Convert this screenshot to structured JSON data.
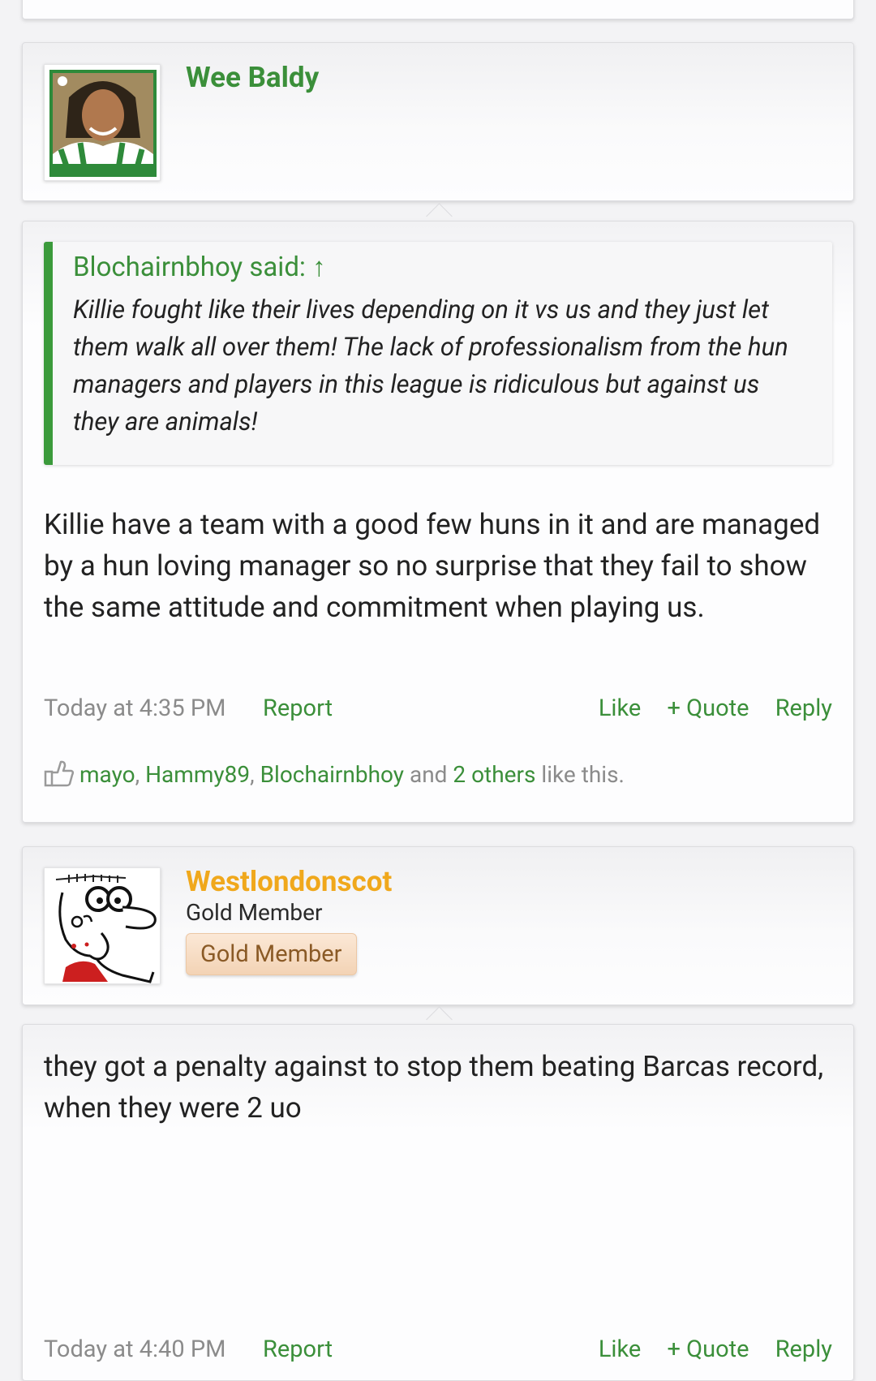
{
  "post1": {
    "username": "Wee Baldy",
    "quote": {
      "attribution": "Blochairnbhoy said: ↑",
      "text": "Killie fought like their lives depending on it vs us and they just let them walk all over them! The lack of professionalism from the hun managers and players in this league is ridiculous but against us they are animals!"
    },
    "message": "Killie have a team with a good few huns in it and are managed by a hun loving manager so no surprise that they fail to show the same attitude and commitment when playing us.",
    "date": "Today at 4:35 PM",
    "report": "Report",
    "like": "Like",
    "quote_btn": "+ Quote",
    "reply": "Reply",
    "likes": {
      "user1": "mayo",
      "sep1": ", ",
      "user2": "Hammy89",
      "sep2": ", ",
      "user3": "Blochairnbhoy",
      "and": " and ",
      "others": "2 others",
      "suffix": " like this."
    }
  },
  "post2": {
    "username": "Westlondonscot",
    "user_title": "Gold Member",
    "banner": "Gold Member",
    "message": "they got a penalty against to stop them beating Barcas record, when they were 2 uo",
    "date": "Today at 4:40 PM",
    "report": "Report",
    "like": "Like",
    "quote_btn": "+ Quote",
    "reply": "Reply"
  },
  "colors": {
    "link_green": "#3b8f3a",
    "quote_bar": "#3b9a3b",
    "gold_username": "#f0a81c",
    "meta_gray": "#8b8b8b"
  }
}
